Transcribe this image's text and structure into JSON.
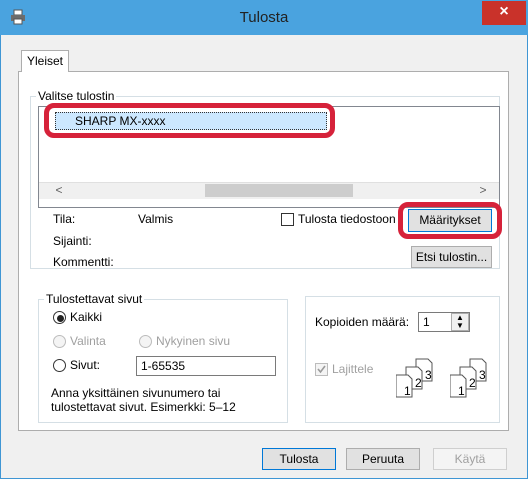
{
  "window": {
    "title": "Tulosta",
    "close_label": "×"
  },
  "tabs": [
    {
      "label": "Yleiset"
    }
  ],
  "printer_group": {
    "label": "Valitse tulostin",
    "selected_printer": "SHARP MX-xxxx",
    "scroll_left": "<",
    "scroll_right": ">"
  },
  "printer_info": {
    "status_label": "Tila:",
    "status_value": "Valmis",
    "location_label": "Sijainti:",
    "comment_label": "Kommentti:",
    "print_to_file_label": "Tulosta tiedostoon",
    "preferences_button": "Määritykset",
    "find_printer_button": "Etsi tulostin..."
  },
  "page_range": {
    "label": "Tulostettavat sivut",
    "all_label": "Kaikki",
    "selection_label": "Valinta",
    "current_page_label": "Nykyinen sivu",
    "pages_label": "Sivut:",
    "pages_value": "1-65535",
    "hint_line1": "Anna yksittäinen sivunumero tai",
    "hint_line2": "tulostettavat sivut. Esimerkki: 5–12"
  },
  "copies": {
    "label": "Kopioiden määrä:",
    "value": "1",
    "collate_label": "Lajittele"
  },
  "footer": {
    "print_button": "Tulosta",
    "cancel_button": "Peruuta",
    "apply_button": "Käytä"
  },
  "colors": {
    "titlebar": "#4aa3df",
    "highlight": "#d6223a",
    "selection": "#cce8ff"
  }
}
